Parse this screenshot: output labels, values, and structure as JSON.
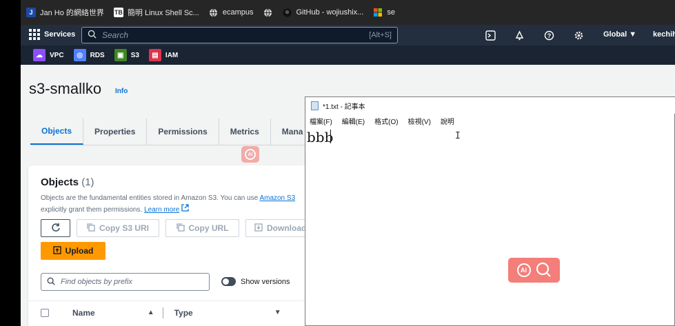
{
  "bookmarks": [
    {
      "label": "Jan Ho 的網絡世界",
      "icon": "jh-logo-icon"
    },
    {
      "label": "簡明 Linux Shell Sc...",
      "icon": "tb-logo-icon"
    },
    {
      "label": "ecampus",
      "icon": "globe-icon"
    },
    {
      "label": "",
      "icon": "globe-icon"
    },
    {
      "label": "GitHub - wojiushix...",
      "icon": "github-icon"
    },
    {
      "label": "se",
      "icon": "windows-logo-icon"
    }
  ],
  "topnav": {
    "services": "Services",
    "search_placeholder": "Search",
    "search_shortcut": "[Alt+S]",
    "region": "Global",
    "account": "kechih"
  },
  "favorites": [
    {
      "label": "VPC",
      "color": "#8c4fff"
    },
    {
      "label": "RDS",
      "color": "#527fff"
    },
    {
      "label": "S3",
      "color": "#3f8624"
    },
    {
      "label": "IAM",
      "color": "#dd344c"
    }
  ],
  "page": {
    "title": "s3-smallko",
    "info": "Info",
    "tabs": [
      "Objects",
      "Properties",
      "Permissions",
      "Metrics",
      "Mana"
    ]
  },
  "objects": {
    "title": "Objects",
    "count": "(1)",
    "desc_line1": "Objects are the fundamental entities stored in Amazon S3. You can use ",
    "desc_link1": "Amazon S3",
    "desc_line2": "explicitly grant them permissions. ",
    "desc_link2": "Learn more",
    "copy_uri": "Copy S3 URI",
    "copy_url": "Copy URL",
    "download": "Download",
    "upload": "Upload",
    "find_placeholder": "Find objects by prefix",
    "show_versions": "Show versions",
    "columns": [
      "Name",
      "Type"
    ]
  },
  "notepad": {
    "title": "*1.txt - 記事本",
    "menu": [
      "檔案(F)",
      "編輯(E)",
      "格式(O)",
      "檢視(V)",
      "說明"
    ],
    "content": "bbb"
  },
  "colors": {
    "aws_nav": "#232f3e",
    "accent": "#0972d3",
    "upload": "#ff9900",
    "ai_badge": "#f26761"
  }
}
